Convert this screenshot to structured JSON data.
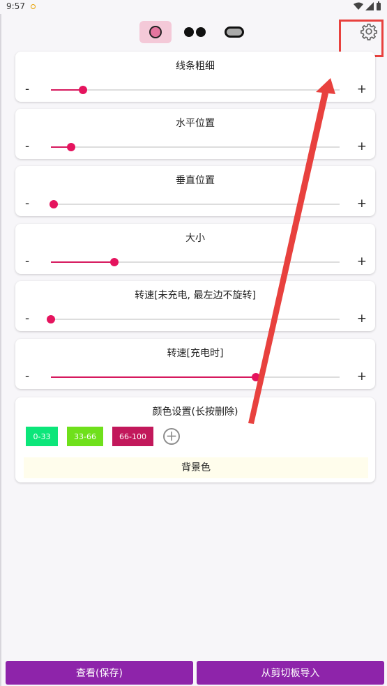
{
  "status": {
    "time": "9:57"
  },
  "mode_buttons": [
    "circle-mode",
    "glasses-mode",
    "pill-mode"
  ],
  "sliders": [
    {
      "label": "线条粗细",
      "minus": "-",
      "plus": "+",
      "fill": 0.11
    },
    {
      "label": "水平位置",
      "minus": "-",
      "plus": "+",
      "fill": 0.07
    },
    {
      "label": "垂直位置",
      "minus": "-",
      "plus": "+",
      "fill": 0.01
    },
    {
      "label": "大小",
      "minus": "-",
      "plus": "+",
      "fill": 0.22
    },
    {
      "label": "转速[未充电, 最左边不旋转]",
      "minus": "-",
      "plus": "+",
      "fill": 0.0
    },
    {
      "label": "转速[充电时]",
      "minus": "-",
      "plus": "+",
      "fill": 0.71
    }
  ],
  "color_settings": {
    "title": "颜色设置(长按删除)",
    "swatches": [
      {
        "label": "0-33",
        "color": "#0ce67a"
      },
      {
        "label": "33-66",
        "color": "#6fe01b"
      },
      {
        "label": "66-100",
        "color": "#c2185b"
      }
    ],
    "add_symbol": "+",
    "background_label": "背景色"
  },
  "footer": {
    "view_save": "查看(保存)",
    "import_clipboard": "从剪切板导入"
  },
  "colors": {
    "accent": "#e5145e",
    "button": "#8e24aa",
    "annotation": "#e8413e"
  }
}
